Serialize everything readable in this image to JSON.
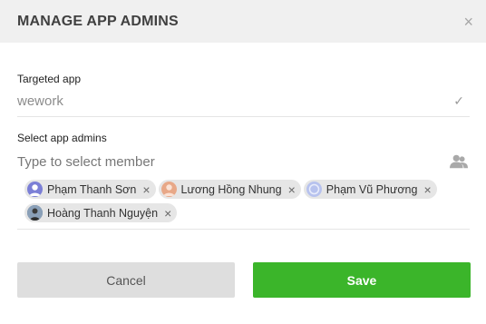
{
  "modal": {
    "title": "MANAGE APP ADMINS",
    "close_symbol": "×"
  },
  "targeted_app": {
    "label": "Targeted app",
    "value": "wework",
    "check_symbol": "✓"
  },
  "admins": {
    "label": "Select app admins",
    "placeholder": "Type to select member",
    "people_icon": "people-icon",
    "selected": [
      {
        "name": "Phạm Thanh Sơn",
        "avatar_color": "#7b7fd6"
      },
      {
        "name": "Lương Hồng Nhung",
        "avatar_color": "#e8a888"
      },
      {
        "name": "Phạm Vũ Phương",
        "avatar_color": "#b7c2ee"
      },
      {
        "name": "Hoàng Thanh Nguyện",
        "avatar_color": "#56708e"
      }
    ]
  },
  "buttons": {
    "cancel": "Cancel",
    "save": "Save"
  },
  "colors": {
    "header_bg": "#f0f0f0",
    "save_green": "#3bb52a",
    "cancel_gray": "#dedede"
  }
}
